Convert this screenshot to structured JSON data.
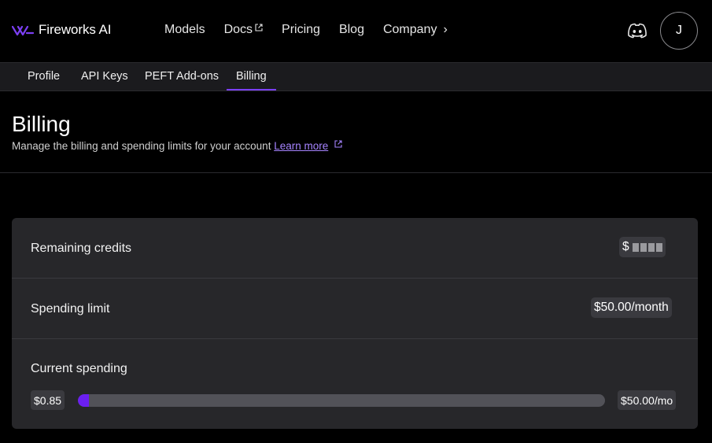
{
  "brand": {
    "name": "Fireworks AI",
    "color": "#6b1ff0"
  },
  "nav": {
    "links": [
      "Models",
      "Docs",
      "Pricing",
      "Blog",
      "Company"
    ],
    "avatar_initial": "J"
  },
  "subnav": {
    "tabs": [
      "Profile",
      "API Keys",
      "PEFT Add-ons",
      "Billing"
    ],
    "active": "Billing"
  },
  "header": {
    "title": "Billing",
    "description": "Manage the billing and spending limits for your account",
    "learn_more": "Learn more"
  },
  "billing": {
    "remaining_credits_label": "Remaining credits",
    "remaining_credits_prefix": "$",
    "spending_limit_label": "Spending limit",
    "spending_limit_value": "$50.00/month",
    "current_spending_label": "Current spending",
    "current_spending_value": "$0.85",
    "current_spending_max": "$50.00/mo",
    "spending_fraction": 0.017
  }
}
